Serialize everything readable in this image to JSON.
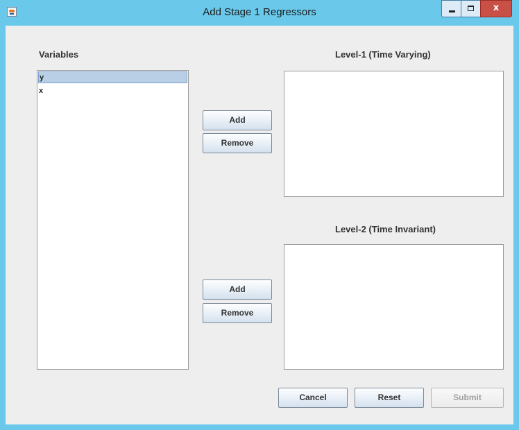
{
  "window": {
    "title": "Add Stage 1 Regressors",
    "close_glyph": "x"
  },
  "variables": {
    "heading": "Variables",
    "items": [
      {
        "label": "y",
        "selected": true
      },
      {
        "label": "x",
        "selected": false
      }
    ]
  },
  "level1": {
    "heading": "Level-1 (Time Varying)",
    "add_label": "Add",
    "remove_label": "Remove",
    "items": []
  },
  "level2": {
    "heading": "Level-2 (Time Invariant)",
    "add_label": "Add",
    "remove_label": "Remove",
    "items": []
  },
  "footer": {
    "cancel_label": "Cancel",
    "reset_label": "Reset",
    "submit_label": "Submit",
    "submit_enabled": false
  },
  "icons": {
    "app": "java-app-icon",
    "minimize": "minimize-icon",
    "maximize": "maximize-icon",
    "close": "close-icon"
  }
}
